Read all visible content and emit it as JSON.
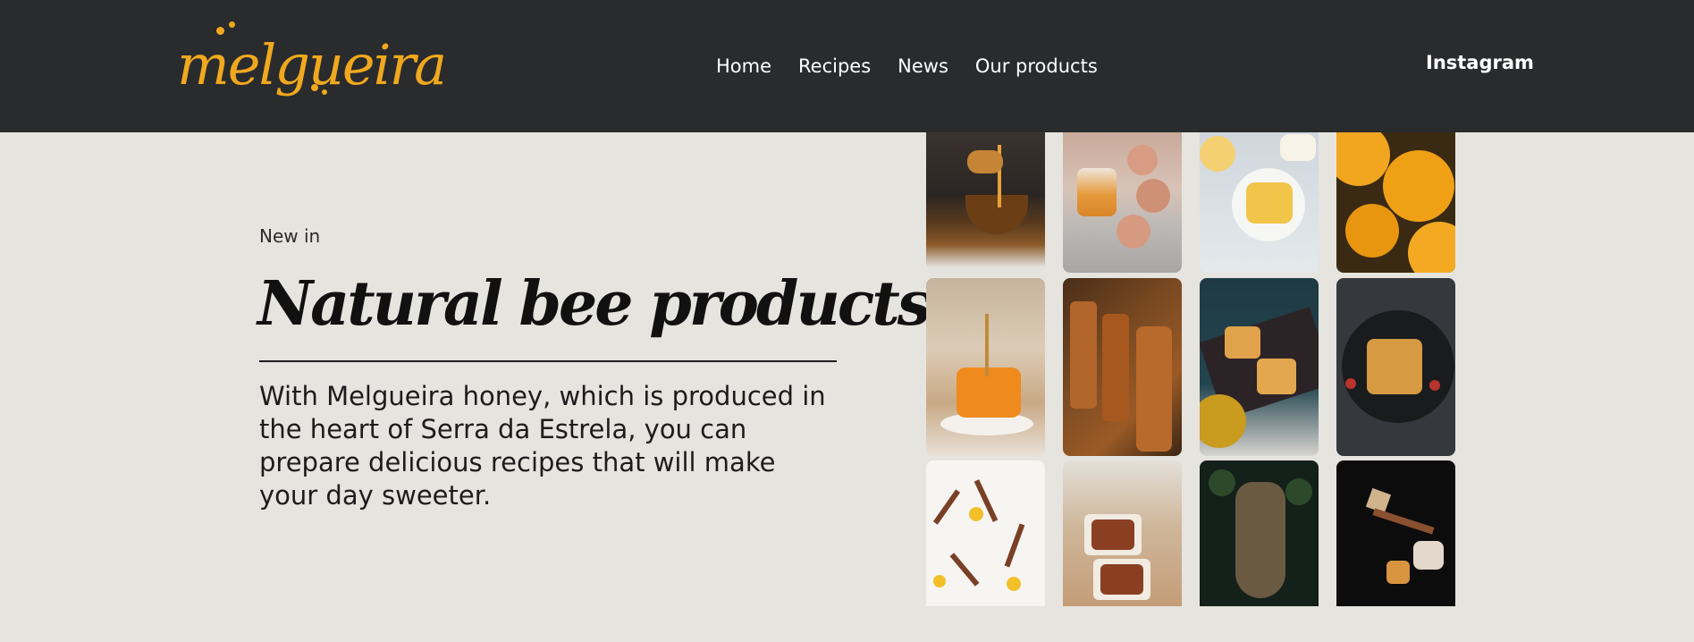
{
  "header": {
    "logo_text": "melgueira",
    "nav": [
      {
        "label": "Home"
      },
      {
        "label": "Recipes"
      },
      {
        "label": "News"
      },
      {
        "label": "Our products"
      }
    ],
    "social_link": "Instagram"
  },
  "hero": {
    "eyebrow": "New in",
    "title": "Natural bee products",
    "description": "With Melgueira honey, which is produced in the heart of Serra da Estrela, you can prepare delicious recipes that will make your day sweeter."
  },
  "colors": {
    "topbar": "#2a2b2d",
    "brand": "#f0a81e",
    "background": "#e6e4df"
  },
  "gallery": {
    "icons": [
      "honey-dipper-bowl-photo",
      "honey-jar-roses-photo",
      "crepes-honey-photo",
      "yellow-flowers-bee-photo",
      "honeycomb-plate-photo",
      "honey-jars-shelf-photo",
      "honeycomb-board-photo",
      "waffle-plate-photo",
      "cinnamon-lemon-photo",
      "honey-cakes-photo",
      "wild-beehive-photo",
      "honey-crystals-photo"
    ]
  }
}
